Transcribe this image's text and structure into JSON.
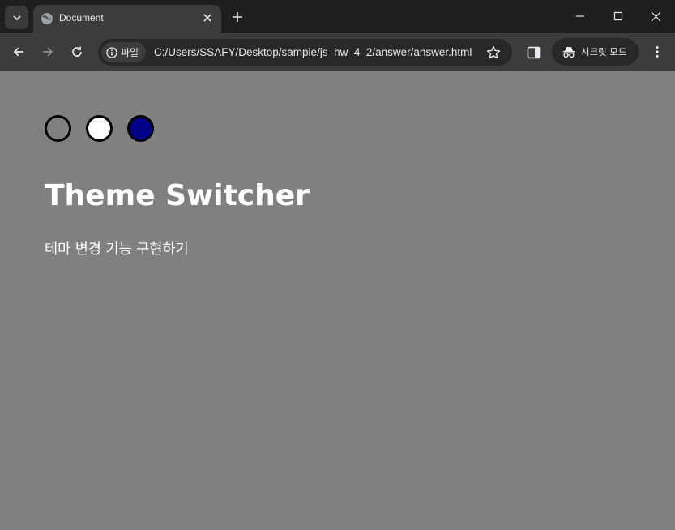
{
  "browser": {
    "tab": {
      "title": "Document"
    },
    "address": {
      "chip_label": "파일",
      "url": "C:/Users/SSAFY/Desktop/sample/js_hw_4_2/answer/answer.html"
    },
    "incognito_label": "시크릿 모드"
  },
  "page": {
    "theme_buttons": [
      {
        "name": "gray",
        "color": "#808080"
      },
      {
        "name": "white",
        "color": "#ffffff"
      },
      {
        "name": "navy",
        "color": "#00008b"
      }
    ],
    "title": "Theme Switcher",
    "description": "테마 변경 기능 구현하기",
    "background_color": "#808080"
  }
}
